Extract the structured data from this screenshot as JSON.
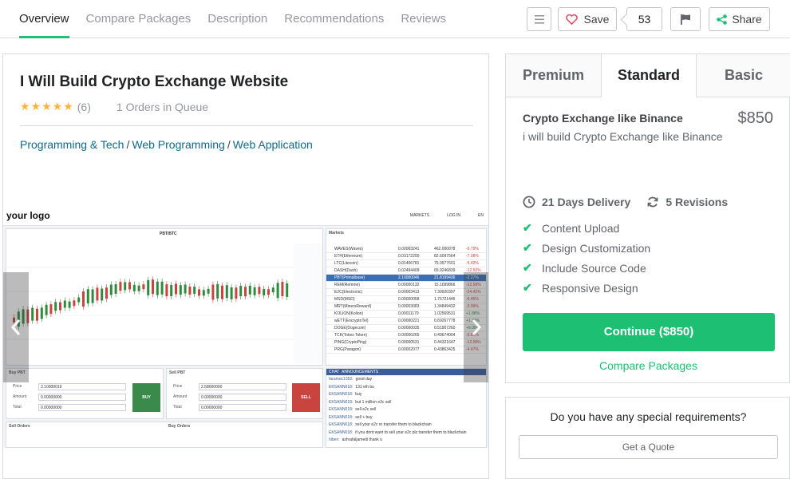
{
  "nav": {
    "tabs": [
      "Overview",
      "Compare Packages",
      "Description",
      "Recommendations",
      "Reviews"
    ],
    "save_label": "Save",
    "save_count": "53",
    "share_label": "Share"
  },
  "gig": {
    "title": "I Will Build Crypto Exchange Website",
    "stars": "★★★★★",
    "rating_count": "(6)",
    "orders_in_queue": "1 Orders in Queue",
    "breadcrumb": [
      "Programming & Tech",
      "Web Programming",
      "Web Application"
    ],
    "breadcrumb_sep": "/"
  },
  "gallery": {
    "logo": "your logo",
    "links": [
      "MARKETS",
      "LOG IN",
      "EN"
    ],
    "pair": "PBT/BTC",
    "markets_title": "Markets",
    "buy_title": "Buy PBT",
    "sell_title": "Sell PBT",
    "buy_label": "BUY",
    "sell_label": "SELL",
    "sell_orders": "Sell Orders",
    "buy_orders": "Buy Orders",
    "chat": "CHAT",
    "announcements": "ANNOUNCEMENTS",
    "price_label": "Price",
    "amount_label": "Amount",
    "total_label": "Total",
    "buy_price": "2.10000019",
    "sell_price": "2.58000000",
    "zero": "0.00000000",
    "markets": [
      [
        "WAVES(Waves)",
        "0.00063241",
        "462.000078",
        "-6.79%"
      ],
      [
        "ETH(Ethereum)",
        "0.03172200",
        "82.6097564",
        "-7.08%"
      ],
      [
        "LTC(Litecoin)",
        "0.01406781",
        "75.0577601",
        "-5.42%"
      ],
      [
        "DASH(Dash)",
        "0.02494409",
        "65.9246839",
        "-12.50%"
      ],
      [
        "PBT(Primalbase)",
        "2.10000046",
        "21.8199436",
        "-2.27%"
      ],
      [
        "REM(Remme)",
        "0.00000132",
        "15.1099866",
        "-12.58%"
      ],
      [
        "E2C(Electronic)",
        "0.00003413",
        "7.39920397",
        "-24.42%"
      ],
      [
        "MSD(MSD)",
        "0.00000058",
        "1.75721446",
        "-6.45%"
      ],
      [
        "MRT(MinersReward)",
        "0.00003083",
        "1.34849432",
        "-3.99%"
      ],
      [
        "KOLION(Kolion)",
        "0.00011179",
        "1.02569531",
        "+1.88%"
      ],
      [
        "wETT(EncryptoTel)",
        "0.00000221",
        "0.69267778",
        "+1.38%"
      ],
      [
        "DOGE(Dogecoin)",
        "0.00000035",
        "0.51907260",
        "+9.08%"
      ],
      [
        "TCK(Tokes Token)",
        "0.00000265",
        "0.49674004",
        "-9.86%"
      ],
      [
        "PING(CryptoPing)",
        "0.00000531",
        "0.44321647",
        "-12.08%"
      ],
      [
        "PRG(Paragon)",
        "0.00002077",
        "0.43863425",
        "-4.47%"
      ]
    ],
    "chat_lines": [
      [
        "faramoc1352:",
        "good day"
      ],
      [
        "EKSANN018:",
        "131 eth bu"
      ],
      [
        "EKSANN018:",
        "buy"
      ],
      [
        "EKSANN018:",
        "but 1 million e2c sell"
      ],
      [
        "EKSANN018:",
        "sell e2c sell"
      ],
      [
        "EKSANN018:",
        "sell + buy"
      ],
      [
        "EKSANN018:",
        "sell your e2c or transfer them to blackchain"
      ],
      [
        "EKSANN018:",
        "if you dont want to sell your e2c plz transfer them to blackchain"
      ],
      [
        "hiben:",
        "ashrafaljamedi thank u"
      ]
    ]
  },
  "package": {
    "tabs": [
      "Premium",
      "Standard",
      "Basic"
    ],
    "name": "Crypto Exchange like Binance",
    "price": "$850",
    "description": "i will build Crypto Exchange like Binance",
    "delivery": "21 Days Delivery",
    "revisions": "5 Revisions",
    "features": [
      "Content Upload",
      "Design Customization",
      "Include Source Code",
      "Responsive Design"
    ],
    "continue_label": "Continue ($850)",
    "compare_label": "Compare Packages",
    "accent_color": "#1dbf73"
  },
  "quote": {
    "question": "Do you have any special requirements?",
    "button_label": "Get a Quote"
  }
}
